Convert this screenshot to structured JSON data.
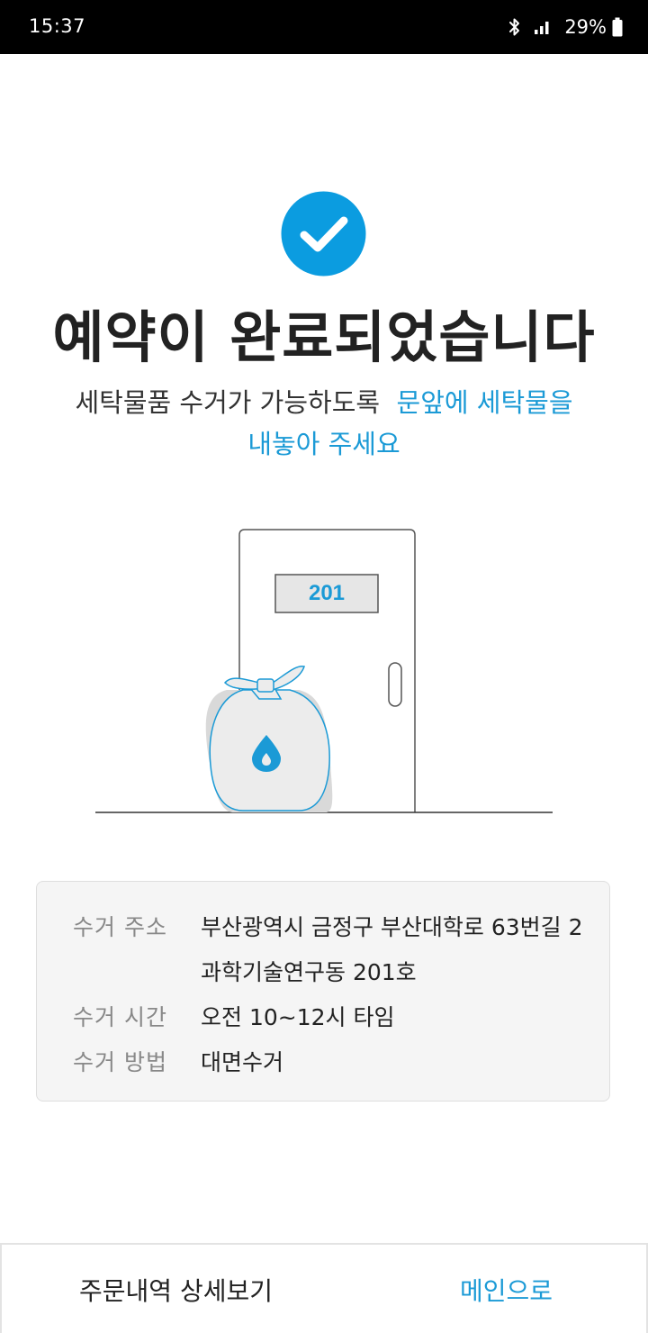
{
  "status_bar": {
    "time": "15:37",
    "battery_percent": "29%",
    "icons": [
      "bluetooth-icon",
      "signal-icon",
      "battery-icon"
    ]
  },
  "confirmation": {
    "icon": "check-circle-icon",
    "title": "예약이 완료되었습니다",
    "subtitle_plain": "세탁물품 수거가 가능하도록",
    "subtitle_highlight_1": "문앞에 세탁물을",
    "subtitle_highlight_2": "내놓아 주세요"
  },
  "illustration": {
    "room_number": "201",
    "bag_icon": "water-drop-icon"
  },
  "pickup_info": {
    "address_label": "수거 주소",
    "address_line1": "부산광역시 금정구 부산대학로 63번길 2",
    "address_line2": "과학기술연구동 201호",
    "time_label": "수거 시간",
    "time_value": "오전 10~12시 타임",
    "method_label": "수거 방법",
    "method_value": "대면수거"
  },
  "actions": {
    "detail_label": "주문내역 상세보기",
    "main_label": "메인으로"
  },
  "colors": {
    "accent": "#1b9ad6",
    "check": "#0b9ce0",
    "text": "#222222",
    "muted": "#888888",
    "card_bg": "#f5f5f5"
  }
}
